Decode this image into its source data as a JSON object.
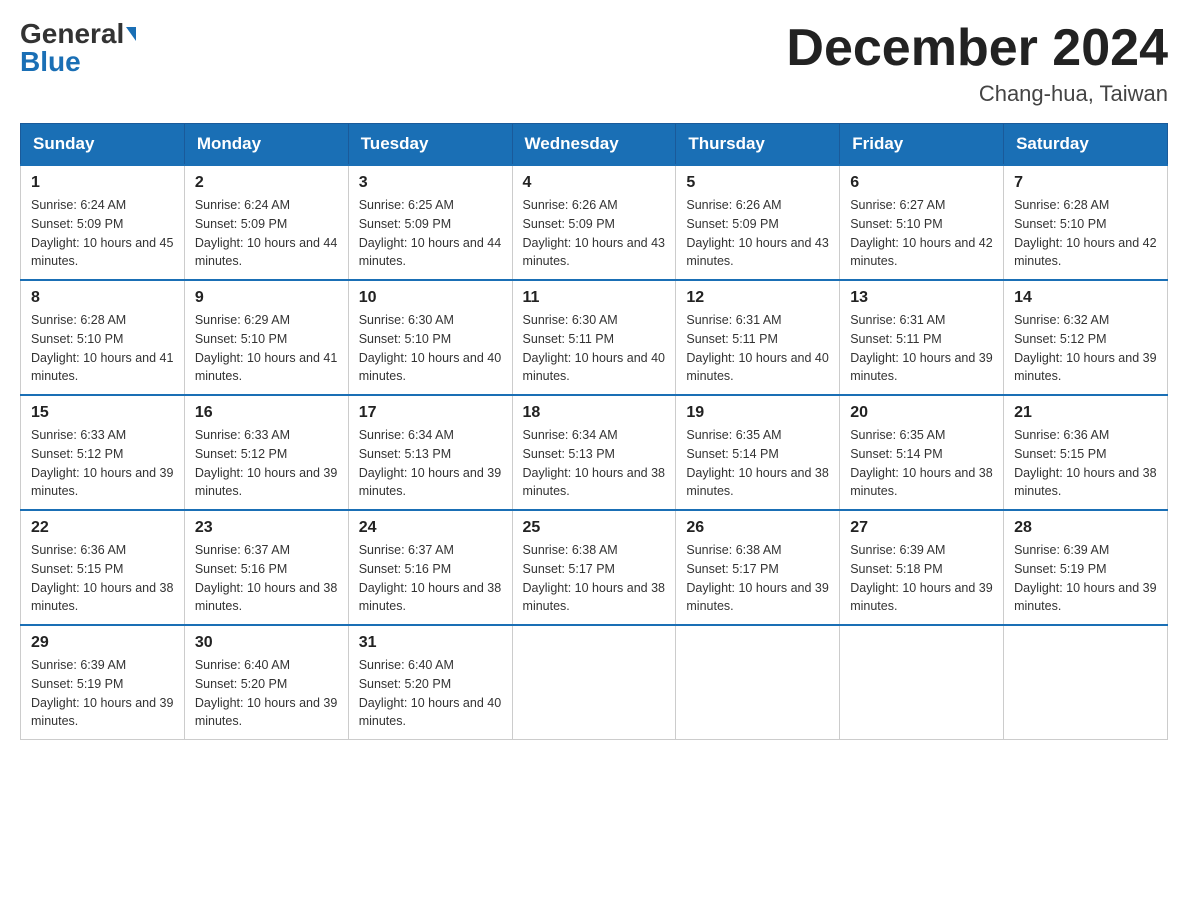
{
  "logo": {
    "general": "General",
    "blue": "Blue"
  },
  "title": "December 2024",
  "location": "Chang-hua, Taiwan",
  "weekdays": [
    "Sunday",
    "Monday",
    "Tuesday",
    "Wednesday",
    "Thursday",
    "Friday",
    "Saturday"
  ],
  "weeks": [
    [
      {
        "day": "1",
        "sunrise": "6:24 AM",
        "sunset": "5:09 PM",
        "daylight": "10 hours and 45 minutes."
      },
      {
        "day": "2",
        "sunrise": "6:24 AM",
        "sunset": "5:09 PM",
        "daylight": "10 hours and 44 minutes."
      },
      {
        "day": "3",
        "sunrise": "6:25 AM",
        "sunset": "5:09 PM",
        "daylight": "10 hours and 44 minutes."
      },
      {
        "day": "4",
        "sunrise": "6:26 AM",
        "sunset": "5:09 PM",
        "daylight": "10 hours and 43 minutes."
      },
      {
        "day": "5",
        "sunrise": "6:26 AM",
        "sunset": "5:09 PM",
        "daylight": "10 hours and 43 minutes."
      },
      {
        "day": "6",
        "sunrise": "6:27 AM",
        "sunset": "5:10 PM",
        "daylight": "10 hours and 42 minutes."
      },
      {
        "day": "7",
        "sunrise": "6:28 AM",
        "sunset": "5:10 PM",
        "daylight": "10 hours and 42 minutes."
      }
    ],
    [
      {
        "day": "8",
        "sunrise": "6:28 AM",
        "sunset": "5:10 PM",
        "daylight": "10 hours and 41 minutes."
      },
      {
        "day": "9",
        "sunrise": "6:29 AM",
        "sunset": "5:10 PM",
        "daylight": "10 hours and 41 minutes."
      },
      {
        "day": "10",
        "sunrise": "6:30 AM",
        "sunset": "5:10 PM",
        "daylight": "10 hours and 40 minutes."
      },
      {
        "day": "11",
        "sunrise": "6:30 AM",
        "sunset": "5:11 PM",
        "daylight": "10 hours and 40 minutes."
      },
      {
        "day": "12",
        "sunrise": "6:31 AM",
        "sunset": "5:11 PM",
        "daylight": "10 hours and 40 minutes."
      },
      {
        "day": "13",
        "sunrise": "6:31 AM",
        "sunset": "5:11 PM",
        "daylight": "10 hours and 39 minutes."
      },
      {
        "day": "14",
        "sunrise": "6:32 AM",
        "sunset": "5:12 PM",
        "daylight": "10 hours and 39 minutes."
      }
    ],
    [
      {
        "day": "15",
        "sunrise": "6:33 AM",
        "sunset": "5:12 PM",
        "daylight": "10 hours and 39 minutes."
      },
      {
        "day": "16",
        "sunrise": "6:33 AM",
        "sunset": "5:12 PM",
        "daylight": "10 hours and 39 minutes."
      },
      {
        "day": "17",
        "sunrise": "6:34 AM",
        "sunset": "5:13 PM",
        "daylight": "10 hours and 39 minutes."
      },
      {
        "day": "18",
        "sunrise": "6:34 AM",
        "sunset": "5:13 PM",
        "daylight": "10 hours and 38 minutes."
      },
      {
        "day": "19",
        "sunrise": "6:35 AM",
        "sunset": "5:14 PM",
        "daylight": "10 hours and 38 minutes."
      },
      {
        "day": "20",
        "sunrise": "6:35 AM",
        "sunset": "5:14 PM",
        "daylight": "10 hours and 38 minutes."
      },
      {
        "day": "21",
        "sunrise": "6:36 AM",
        "sunset": "5:15 PM",
        "daylight": "10 hours and 38 minutes."
      }
    ],
    [
      {
        "day": "22",
        "sunrise": "6:36 AM",
        "sunset": "5:15 PM",
        "daylight": "10 hours and 38 minutes."
      },
      {
        "day": "23",
        "sunrise": "6:37 AM",
        "sunset": "5:16 PM",
        "daylight": "10 hours and 38 minutes."
      },
      {
        "day": "24",
        "sunrise": "6:37 AM",
        "sunset": "5:16 PM",
        "daylight": "10 hours and 38 minutes."
      },
      {
        "day": "25",
        "sunrise": "6:38 AM",
        "sunset": "5:17 PM",
        "daylight": "10 hours and 38 minutes."
      },
      {
        "day": "26",
        "sunrise": "6:38 AM",
        "sunset": "5:17 PM",
        "daylight": "10 hours and 39 minutes."
      },
      {
        "day": "27",
        "sunrise": "6:39 AM",
        "sunset": "5:18 PM",
        "daylight": "10 hours and 39 minutes."
      },
      {
        "day": "28",
        "sunrise": "6:39 AM",
        "sunset": "5:19 PM",
        "daylight": "10 hours and 39 minutes."
      }
    ],
    [
      {
        "day": "29",
        "sunrise": "6:39 AM",
        "sunset": "5:19 PM",
        "daylight": "10 hours and 39 minutes."
      },
      {
        "day": "30",
        "sunrise": "6:40 AM",
        "sunset": "5:20 PM",
        "daylight": "10 hours and 39 minutes."
      },
      {
        "day": "31",
        "sunrise": "6:40 AM",
        "sunset": "5:20 PM",
        "daylight": "10 hours and 40 minutes."
      },
      null,
      null,
      null,
      null
    ]
  ]
}
